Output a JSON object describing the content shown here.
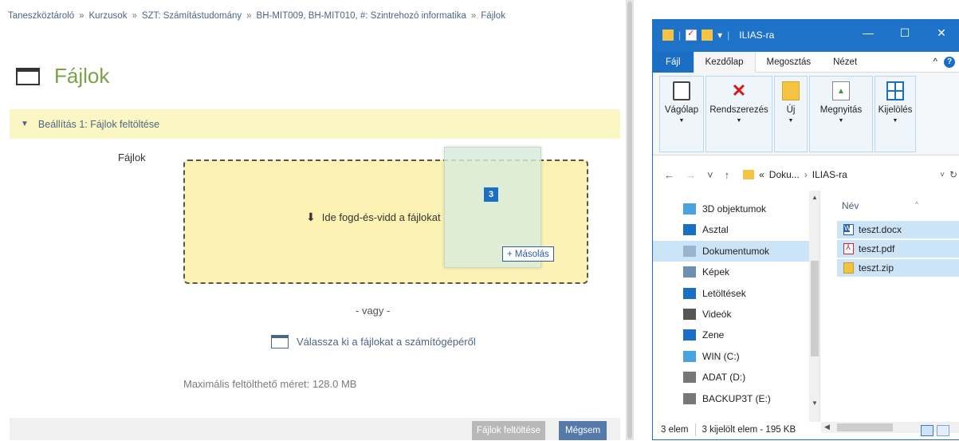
{
  "breadcrumb": [
    "Taneszköztároló",
    "Kurzusok",
    "SZT: Számítástudomány",
    "BH-MIT009, BH-MIT010, #: Szintrehozó informatika",
    "Fájlok"
  ],
  "breadcrumb_sep": "»",
  "page": {
    "title": "Fájlok"
  },
  "section": {
    "title": "Beállítás 1: Fájlok feltöltése",
    "toggle": "▼"
  },
  "form": {
    "files_label": "Fájlok",
    "dropzone_text": "Ide fogd-és-vidd a fájlokat",
    "drag_count": "3",
    "copy_tooltip": "+ Másolás",
    "or_text": "- vagy -",
    "choose_files": "Válassza ki a fájlokat a számítógépéről",
    "max_size": "Maximális feltölthető méret: 128.0 MB"
  },
  "footer": {
    "upload_button": "Fájlok feltöltése",
    "cancel_button": "Mégsem"
  },
  "explorer": {
    "title": "ILIAS-ra",
    "window_buttons": {
      "minimize": "—",
      "maximize": "☐",
      "close": "✕"
    },
    "tabs": [
      "Fájl",
      "Kezdőlap",
      "Megosztás",
      "Nézet"
    ],
    "ribbon": [
      "Vágólap",
      "Rendszerezés",
      "Új",
      "Megnyitás",
      "Kijelölés"
    ],
    "address": {
      "prefix": "«",
      "path": [
        "Doku...",
        "ILIAS-ra"
      ],
      "sep": "›"
    },
    "nav_items": [
      {
        "label": "3D objektumok",
        "icon": "3d-objects-icon",
        "color": "#4aa3df"
      },
      {
        "label": "Asztal",
        "icon": "desktop-icon",
        "color": "#1a6fc4"
      },
      {
        "label": "Dokumentumok",
        "icon": "documents-icon",
        "color": "#9ab3cf"
      },
      {
        "label": "Képek",
        "icon": "pictures-icon",
        "color": "#6f8fb0"
      },
      {
        "label": "Letöltések",
        "icon": "downloads-icon",
        "color": "#1a6fc4"
      },
      {
        "label": "Videók",
        "icon": "videos-icon",
        "color": "#555555"
      },
      {
        "label": "Zene",
        "icon": "music-icon",
        "color": "#1a6fc4"
      },
      {
        "label": "WIN (C:)",
        "icon": "drive-c-icon",
        "color": "#4aa3df"
      },
      {
        "label": "ADAT (D:)",
        "icon": "drive-d-icon",
        "color": "#777777"
      },
      {
        "label": "BACKUP3T (E:)",
        "icon": "drive-e-icon",
        "color": "#777777"
      }
    ],
    "column_header": "Név",
    "files": [
      {
        "name": "teszt.docx",
        "type": "docx"
      },
      {
        "name": "teszt.pdf",
        "type": "pdf"
      },
      {
        "name": "teszt.zip",
        "type": "zip"
      }
    ],
    "status": {
      "count": "3 elem",
      "selected": "3 kijelölt elem - 195 KB"
    }
  },
  "colors": {
    "accent_green": "#7da04a",
    "section_bg": "#fbf7c5",
    "dropzone_bg": "#fbf2b3",
    "explorer_blue": "#1e73c8",
    "selection": "#cce4f7"
  }
}
